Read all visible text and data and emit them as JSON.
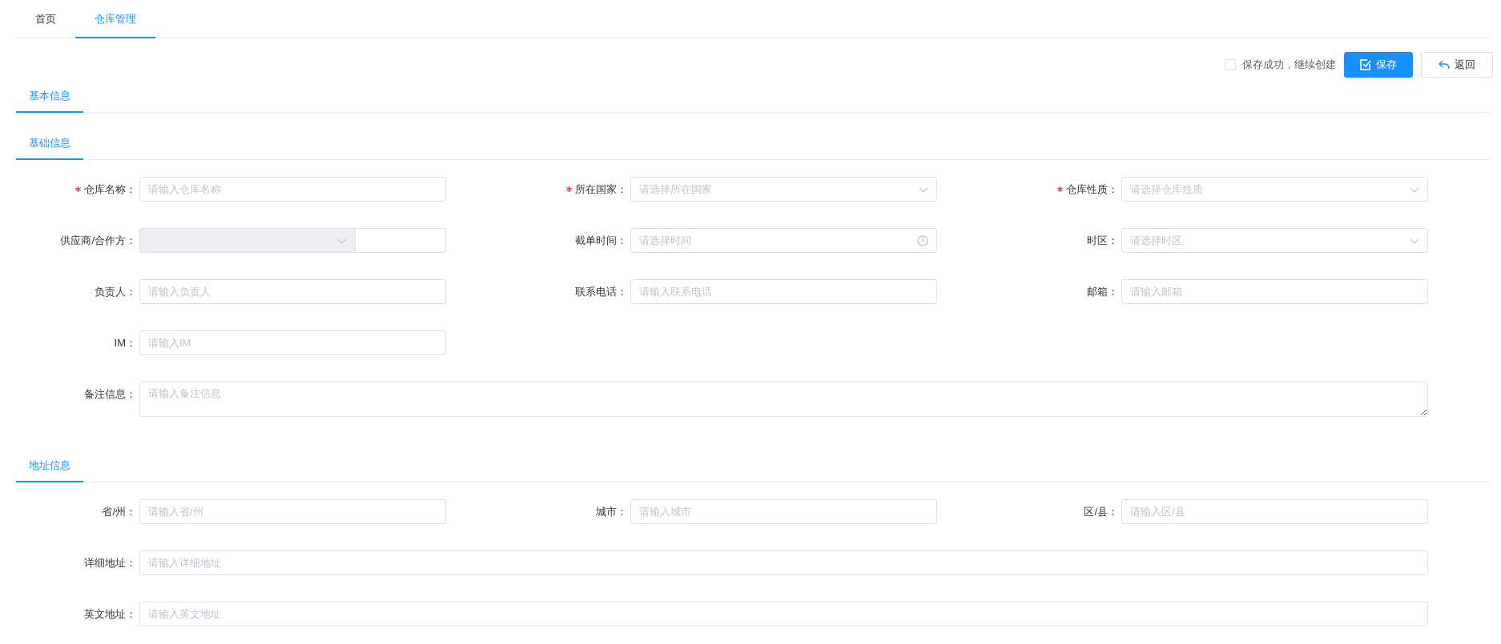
{
  "tabs": [
    {
      "label": "首页",
      "selected": false
    },
    {
      "label": "仓库管理",
      "selected": true
    }
  ],
  "continue_create": {
    "label": "保存成功，继续创建",
    "checked": false
  },
  "buttons": [
    {
      "label": "保存",
      "kind": "primary"
    },
    {
      "label": "返回",
      "kind": "back"
    }
  ],
  "section_tabs": [
    {
      "label": "基本信息",
      "selected": true
    }
  ],
  "groups": [
    {
      "title": "基础信息",
      "rows": [
        [
          {
            "label": "仓库名称：",
            "required": true,
            "kind": "text",
            "placeholder": "请输入仓库名称"
          },
          {
            "label": "所在国家：",
            "required": true,
            "kind": "select",
            "placeholder": "请选择所在国家"
          },
          {
            "label": "仓库性质：",
            "required": true,
            "kind": "select",
            "placeholder": "请选择仓库性质"
          }
        ],
        [
          {
            "label": "供应商/合作方：",
            "required": false,
            "kind": "combo",
            "disabled": true
          },
          {
            "label": "截单时间：",
            "required": false,
            "kind": "time",
            "placeholder": "请选择时间"
          },
          {
            "label": "时区：",
            "required": false,
            "kind": "select",
            "placeholder": "请选择时区"
          }
        ],
        [
          {
            "label": "负责人：",
            "required": false,
            "kind": "text",
            "placeholder": "请输入负责人"
          },
          {
            "label": "联系电话：",
            "required": false,
            "kind": "text",
            "placeholder": "请输入联系电话"
          },
          {
            "label": "邮箱：",
            "required": false,
            "kind": "text",
            "placeholder": "请输入邮箱"
          }
        ],
        [
          {
            "label": "IM：",
            "required": false,
            "kind": "text",
            "placeholder": "请输入IM"
          }
        ],
        [
          {
            "label": "备注信息：",
            "required": false,
            "kind": "textarea",
            "placeholder": "请输入备注信息"
          }
        ]
      ]
    },
    {
      "title": "地址信息",
      "rows": [
        [
          {
            "label": "省/州：",
            "required": false,
            "kind": "text",
            "placeholder": "请输入省/州"
          },
          {
            "label": "城市：",
            "required": false,
            "kind": "text",
            "placeholder": "请输入城市"
          },
          {
            "label": "区/县：",
            "required": false,
            "kind": "text",
            "placeholder": "请输入区/县"
          }
        ],
        [
          {
            "label": "详细地址：",
            "required": false,
            "kind": "line",
            "placeholder": "请输入详细地址"
          }
        ],
        [
          {
            "label": "英文地址：",
            "required": false,
            "kind": "line",
            "placeholder": "请输入英文地址"
          }
        ]
      ]
    }
  ]
}
